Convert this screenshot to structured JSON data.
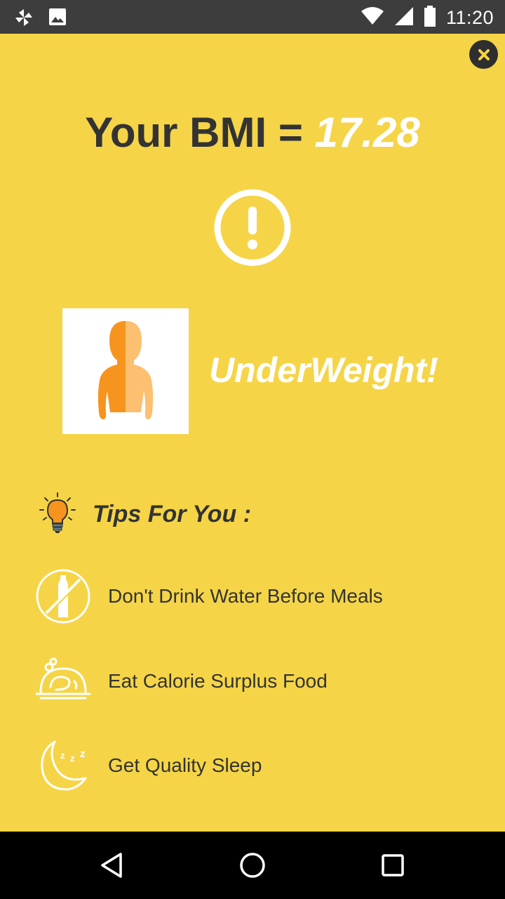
{
  "status_bar": {
    "time": "11:20",
    "left_icons": [
      "pinwheel-icon",
      "image-icon"
    ],
    "right_icons": [
      "wifi-icon",
      "signal-icon",
      "battery-icon"
    ]
  },
  "result": {
    "title_prefix": "Your BMI = ",
    "bmi_value": "17.28",
    "category": "UnderWeight!"
  },
  "tips": {
    "header": "Tips For You :",
    "items": [
      {
        "icon": "no-bottle-icon",
        "text": "Don't Drink Water Before Meals"
      },
      {
        "icon": "food-plate-icon",
        "text": "Eat Calorie Surplus Food"
      },
      {
        "icon": "moon-sleep-icon",
        "text": "Get Quality Sleep"
      }
    ]
  },
  "colors": {
    "background": "#f5d547",
    "text_dark": "#333333",
    "accent_orange": "#f7941d",
    "accent_light_orange": "#fcc070"
  }
}
